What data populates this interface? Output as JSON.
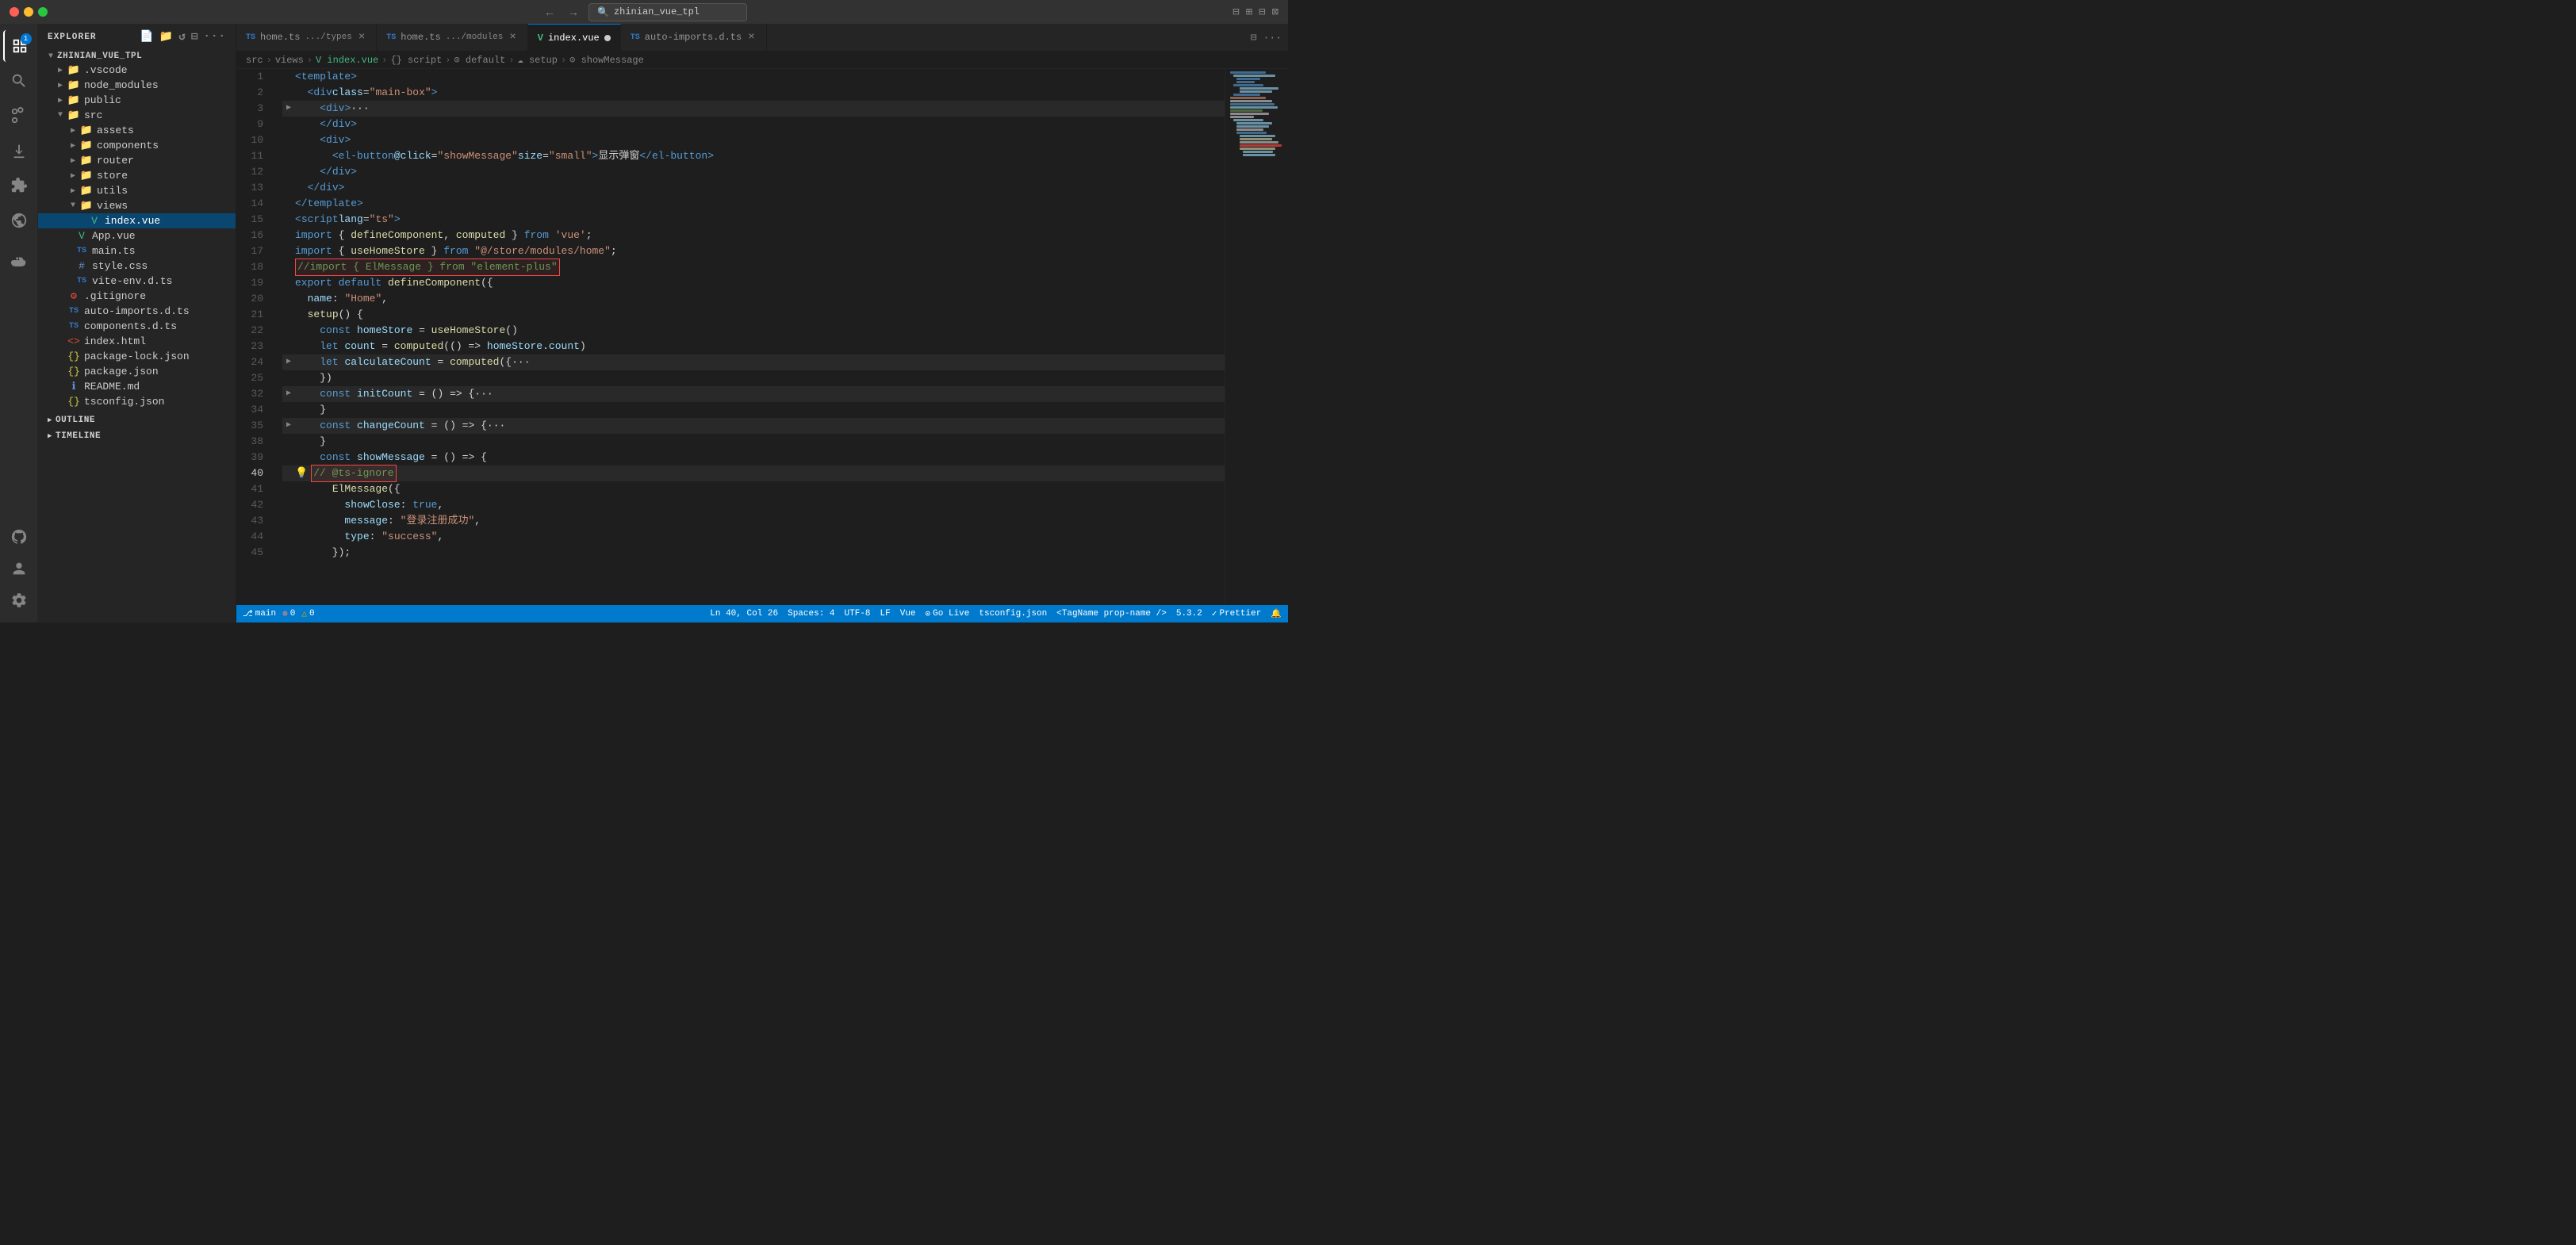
{
  "titleBar": {
    "title": "zhinian_vue_tpl",
    "searchPlaceholder": "zhinian_vue_tpl",
    "backBtn": "←",
    "forwardBtn": "→"
  },
  "tabs": [
    {
      "id": "tab-home-types",
      "icon": "ts",
      "name": "home.ts",
      "path": ".../types",
      "active": false,
      "modified": false
    },
    {
      "id": "tab-home-modules",
      "icon": "ts",
      "name": "home.ts",
      "path": ".../modules",
      "active": false,
      "modified": false
    },
    {
      "id": "tab-index-vue",
      "icon": "vue",
      "name": "index.vue",
      "path": "",
      "active": true,
      "modified": true
    },
    {
      "id": "tab-auto-imports",
      "icon": "ts",
      "name": "auto-imports.d.ts",
      "path": "",
      "active": false,
      "modified": false
    }
  ],
  "breadcrumb": {
    "parts": [
      "src",
      ">",
      "views",
      ">",
      "index.vue",
      ">",
      "{} script",
      ">",
      "⊙ default",
      ">",
      "☁ setup",
      ">",
      "⊙ showMessage"
    ]
  },
  "sidebar": {
    "title": "EXPLORER",
    "projectName": "ZHINIAN_VUE_TPL",
    "tree": [
      {
        "id": "vscode",
        "label": ".vscode",
        "type": "folder",
        "indent": 1,
        "collapsed": true
      },
      {
        "id": "node_modules",
        "label": "node_modules",
        "type": "folder",
        "indent": 1,
        "collapsed": true
      },
      {
        "id": "public",
        "label": "public",
        "type": "folder",
        "indent": 1,
        "collapsed": true
      },
      {
        "id": "src",
        "label": "src",
        "type": "folder",
        "indent": 1,
        "collapsed": false
      },
      {
        "id": "assets",
        "label": "assets",
        "type": "folder",
        "indent": 2,
        "collapsed": true
      },
      {
        "id": "components",
        "label": "components",
        "type": "folder",
        "indent": 2,
        "collapsed": true
      },
      {
        "id": "router",
        "label": "router",
        "type": "folder",
        "indent": 2,
        "collapsed": true
      },
      {
        "id": "store",
        "label": "store",
        "type": "folder",
        "indent": 2,
        "collapsed": true
      },
      {
        "id": "utils",
        "label": "utils",
        "type": "folder",
        "indent": 2,
        "collapsed": true
      },
      {
        "id": "views",
        "label": "views",
        "type": "folder",
        "indent": 2,
        "collapsed": false
      },
      {
        "id": "index-vue",
        "label": "index.vue",
        "type": "vue",
        "indent": 3,
        "selected": true
      },
      {
        "id": "app-vue",
        "label": "App.vue",
        "type": "vue",
        "indent": 2
      },
      {
        "id": "main-ts",
        "label": "main.ts",
        "type": "ts",
        "indent": 2
      },
      {
        "id": "style-css",
        "label": "style.css",
        "type": "css",
        "indent": 2
      },
      {
        "id": "vite-env",
        "label": "vite-env.d.ts",
        "type": "ts",
        "indent": 2
      },
      {
        "id": "gitignore",
        "label": ".gitignore",
        "type": "git",
        "indent": 1
      },
      {
        "id": "auto-imports",
        "label": "auto-imports.d.ts",
        "type": "ts",
        "indent": 1
      },
      {
        "id": "components-d-ts",
        "label": "components.d.ts",
        "type": "ts",
        "indent": 1
      },
      {
        "id": "index-html",
        "label": "index.html",
        "type": "html",
        "indent": 1
      },
      {
        "id": "package-lock",
        "label": "package-lock.json",
        "type": "json",
        "indent": 1
      },
      {
        "id": "package-json",
        "label": "package.json",
        "type": "json",
        "indent": 1
      },
      {
        "id": "readme",
        "label": "README.md",
        "type": "md",
        "indent": 1
      },
      {
        "id": "tsconfig",
        "label": "tsconfig.json",
        "type": "json",
        "indent": 1
      }
    ],
    "outline": {
      "label": "OUTLINE",
      "collapsed": true
    },
    "timeline": {
      "label": "TIMELINE",
      "collapsed": true
    }
  },
  "editor": {
    "filename": "index.vue",
    "lines": [
      {
        "num": 1,
        "content": "<template>"
      },
      {
        "num": 2,
        "content": "  <div class=\"main-box\">"
      },
      {
        "num": 3,
        "content": "    <div>···"
      },
      {
        "num": 9,
        "content": "    </div>"
      },
      {
        "num": 10,
        "content": "    <div>"
      },
      {
        "num": 11,
        "content": "      <el-button @click=\"showMessage\" size=\"small\">显示弹窗</el-button>"
      },
      {
        "num": 12,
        "content": "    </div>"
      },
      {
        "num": 13,
        "content": "  </div>"
      },
      {
        "num": 14,
        "content": "</template>"
      },
      {
        "num": 15,
        "content": "<script lang=\"ts\">"
      },
      {
        "num": 16,
        "content": "import { defineComponent, computed } from 'vue';"
      },
      {
        "num": 17,
        "content": "import { useHomeStore } from \"@/store/modules/home\";"
      },
      {
        "num": 18,
        "content": "//import { ElMessage } from \"element-plus\"",
        "redBox": true
      },
      {
        "num": 19,
        "content": "export default defineComponent({"
      },
      {
        "num": 20,
        "content": "  name: \"Home\","
      },
      {
        "num": 21,
        "content": "  setup() {"
      },
      {
        "num": 22,
        "content": "    const homeStore = useHomeStore()"
      },
      {
        "num": 23,
        "content": "    let count = computed(() => homeStore.count)"
      },
      {
        "num": 24,
        "content": "    let calculateCount = computed({···"
      },
      {
        "num": 25,
        "content": "    })"
      },
      {
        "num": 32,
        "content": "    const initCount = () => {···"
      },
      {
        "num": 34,
        "content": "    }"
      },
      {
        "num": 35,
        "content": "    const changeCount = () => {···"
      },
      {
        "num": 38,
        "content": "    }"
      },
      {
        "num": 39,
        "content": "    const showMessage = () => {"
      },
      {
        "num": 40,
        "content": "      // @ts-ignore",
        "redBox": true,
        "bulb": true,
        "activeLine": true
      },
      {
        "num": 41,
        "content": "      ElMessage({"
      },
      {
        "num": 42,
        "content": "        showClose: true,"
      },
      {
        "num": 43,
        "content": "        message: \"登录注册成功\","
      },
      {
        "num": 44,
        "content": "        type: \"success\","
      },
      {
        "num": 45,
        "content": "      });"
      }
    ]
  },
  "statusBar": {
    "branch": "main",
    "errors": "0",
    "warnings": "0",
    "position": "Ln 40, Col 26",
    "spaces": "Spaces: 4",
    "encoding": "UTF-8",
    "lineEnding": "LF",
    "language": "Vue",
    "goLive": "Go Live",
    "tsconfig": "tsconfig.json",
    "tagName": "<TagName prop-name />",
    "version": "5.3.2",
    "prettier": "Prettier",
    "errorIcon": "⊗",
    "warnIcon": "△",
    "branchIcon": "⎇",
    "bellIcon": "🔔"
  }
}
